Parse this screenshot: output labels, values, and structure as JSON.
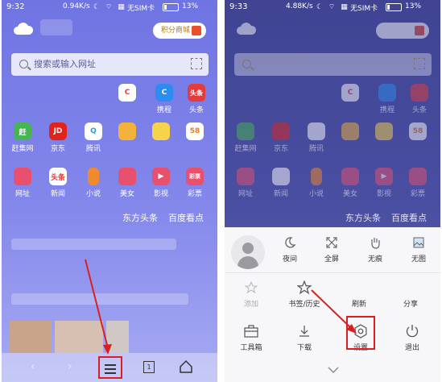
{
  "left": {
    "status": {
      "time": "9:32",
      "speed": "0.94K/s",
      "carrier": "无SIM卡",
      "battery": "13%"
    },
    "points_label": "积分商城",
    "search_placeholder": "搜索或输入网址",
    "row1": [
      {
        "label": "携程",
        "color": "#2c8cf0",
        "icon_text": "C"
      },
      {
        "label": "头条",
        "color": "#e63b3b",
        "icon_text": "头条"
      }
    ],
    "row2": [
      {
        "label": "赶集网",
        "color": "#46b553",
        "icon_text": "赶"
      },
      {
        "label": "京东",
        "color": "#e2231a",
        "icon_text": "JD"
      },
      {
        "label": "腾讯",
        "color": "#ffffff",
        "icon_text": "Q"
      }
    ],
    "row3": [
      {
        "label": "网址"
      },
      {
        "label": "新闻"
      },
      {
        "label": "小说"
      },
      {
        "label": "美女"
      },
      {
        "label": "影视"
      },
      {
        "label": "彩票"
      }
    ],
    "news_tabs": [
      "东方头条",
      "百度看点"
    ]
  },
  "right": {
    "status": {
      "time": "9:33",
      "speed": "4.88K/s",
      "carrier": "无SIM卡",
      "battery": "13%"
    },
    "row1": [
      {
        "label": "携程"
      },
      {
        "label": "头条"
      }
    ],
    "row2": [
      {
        "label": "赶集网"
      },
      {
        "label": "京东"
      },
      {
        "label": "腾讯"
      }
    ],
    "row3": [
      {
        "label": "网址"
      },
      {
        "label": "新闻"
      },
      {
        "label": "小说"
      },
      {
        "label": "美女"
      },
      {
        "label": "影视"
      },
      {
        "label": "彩票"
      }
    ],
    "news_tabs": [
      "东方头条",
      "百度看点"
    ],
    "menu": {
      "top": [
        "夜间",
        "全屏",
        "无痕",
        "无图"
      ],
      "mid": [
        "添加",
        "书签/历史",
        "刷新",
        "分享"
      ],
      "bottom": [
        "工具箱",
        "下载",
        "设置",
        "退出"
      ]
    }
  },
  "colors": {
    "highlight": "#d92020",
    "menu_bg": "#f7f7f9"
  }
}
